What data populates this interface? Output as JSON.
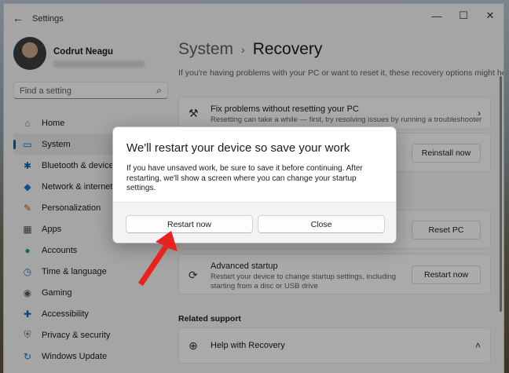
{
  "window": {
    "app_title": "Settings",
    "controls": {
      "minimize": "—",
      "maximize": "☐",
      "close": "✕"
    }
  },
  "profile": {
    "name": "Codrut Neagu"
  },
  "search": {
    "placeholder": "Find a setting"
  },
  "nav": {
    "items": [
      {
        "label": "Home",
        "icon": "home-icon",
        "glyph": "⌂",
        "color": "#c86b2a",
        "active": false
      },
      {
        "label": "System",
        "icon": "system-icon",
        "glyph": "▭",
        "color": "#0067c0",
        "active": true
      },
      {
        "label": "Bluetooth & devices",
        "icon": "bluetooth-icon",
        "glyph": "✱",
        "color": "#0067c0",
        "active": false
      },
      {
        "label": "Network & internet",
        "icon": "network-icon",
        "glyph": "◆",
        "color": "#1a73c9",
        "active": false
      },
      {
        "label": "Personalization",
        "icon": "personalization-icon",
        "glyph": "✎",
        "color": "#c4562a",
        "active": false
      },
      {
        "label": "Apps",
        "icon": "apps-icon",
        "glyph": "▦",
        "color": "#4a5563",
        "active": false
      },
      {
        "label": "Accounts",
        "icon": "accounts-icon",
        "glyph": "●",
        "color": "#2e9a5a",
        "active": false
      },
      {
        "label": "Time & language",
        "icon": "time-language-icon",
        "glyph": "◷",
        "color": "#2a73c4",
        "active": false
      },
      {
        "label": "Gaming",
        "icon": "gaming-icon",
        "glyph": "◉",
        "color": "#5a5a5a",
        "active": false
      },
      {
        "label": "Accessibility",
        "icon": "accessibility-icon",
        "glyph": "✚",
        "color": "#1a62b5",
        "active": false
      },
      {
        "label": "Privacy & security",
        "icon": "shield-icon",
        "glyph": "⛨",
        "color": "#6b6b6b",
        "active": false
      },
      {
        "label": "Windows Update",
        "icon": "windows-update-icon",
        "glyph": "↻",
        "color": "#1a73c9",
        "active": false
      }
    ]
  },
  "main": {
    "breadcrumb": {
      "parent": "System",
      "current": "Recovery"
    },
    "subtitle": "If you're having problems with your PC or want to reset it, these recovery options might help.",
    "fix_card": {
      "title": "Fix problems without resetting your PC",
      "desc": "Resetting can take a while — first, try resolving issues by running a troubleshooter"
    },
    "reinstall_button": "Reinstall now",
    "reset_button": "Reset PC",
    "advanced_card": {
      "title": "Advanced startup",
      "desc": "Restart your device to change startup settings, including starting from a disc or USB drive",
      "button": "Restart now"
    },
    "related_support": "Related support",
    "help_card": {
      "title": "Help with Recovery"
    }
  },
  "dialog": {
    "title": "We'll restart your device so save your work",
    "message": "If you have unsaved work, be sure to save it before continuing. After restarting, we'll show a screen where you can change your startup settings.",
    "primary_button": "Restart now",
    "secondary_button": "Close"
  },
  "colors": {
    "accent": "#005fb8",
    "arrow": "#e8231e"
  }
}
